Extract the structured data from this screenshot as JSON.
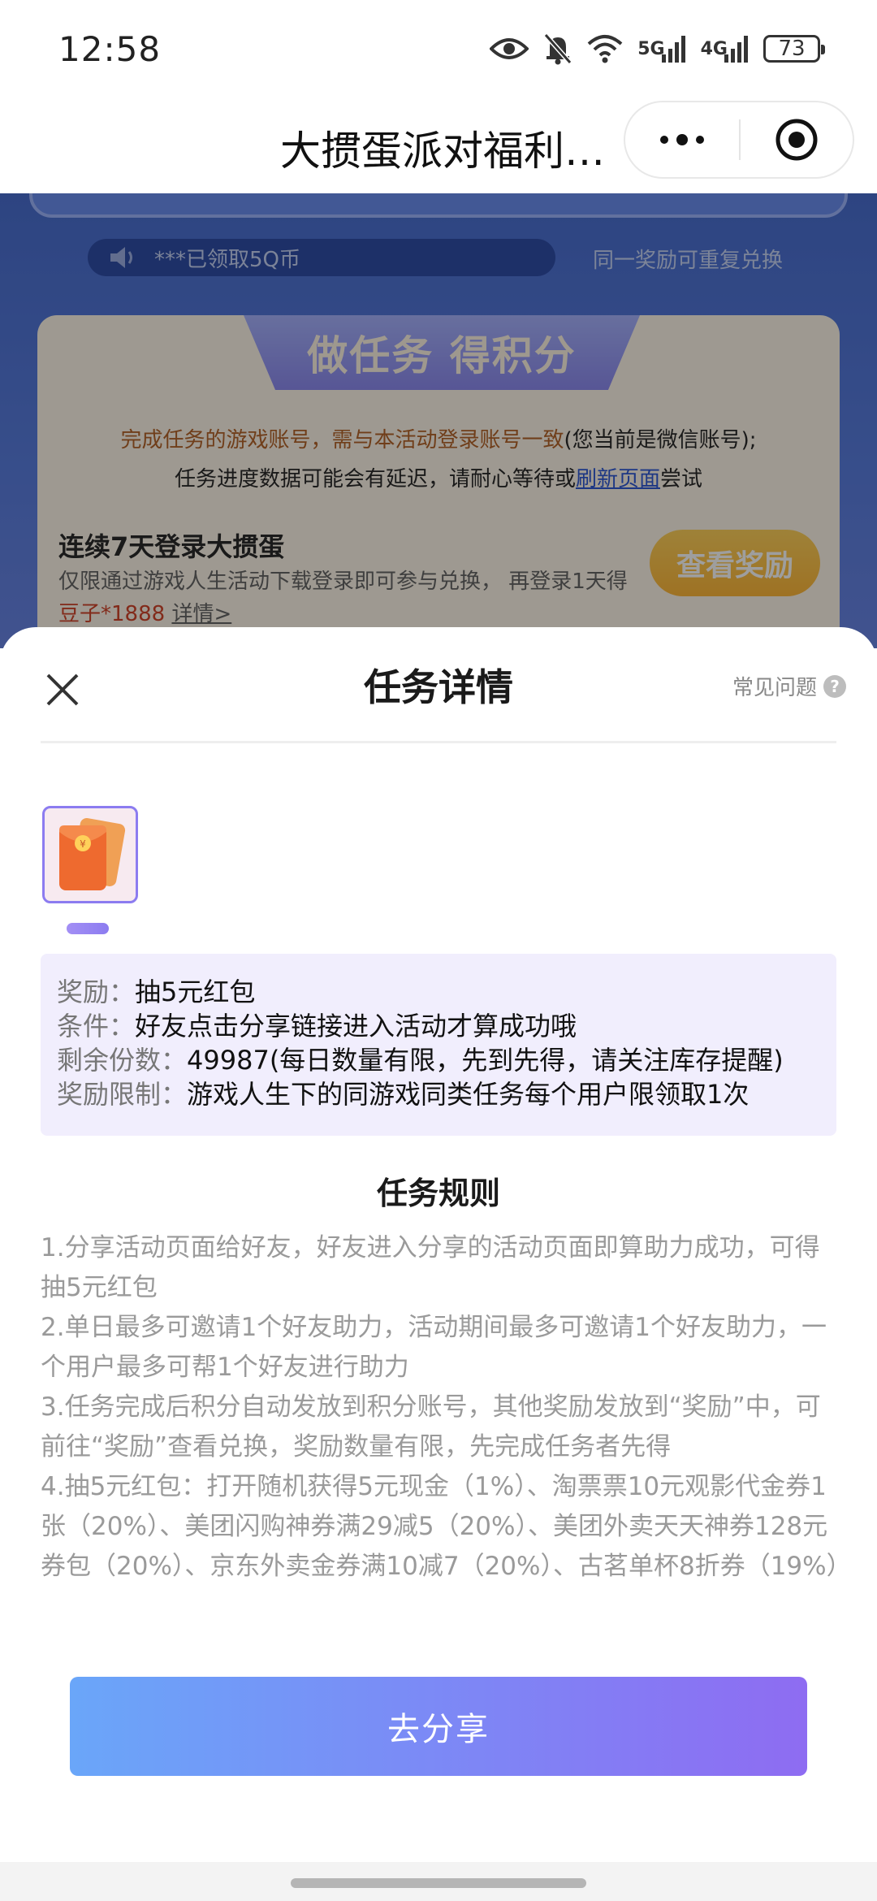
{
  "status_bar": {
    "time": "12:58",
    "network_1": "5G",
    "network_2": "4G",
    "battery": "73",
    "icons": [
      "eye-icon",
      "bell-off-icon",
      "wifi-icon",
      "signal-icon",
      "signal-icon",
      "battery-icon"
    ]
  },
  "nav": {
    "title": "大掼蛋派对福利…",
    "more_icon": "more-dots-icon",
    "close_icon": "target-close-icon"
  },
  "background": {
    "marquee_text": "***已领取5Q币",
    "repeat_text": "同一奖励可重复兑换",
    "banner": "做任务 得积分",
    "notice_warn": "完成任务的游戏账号，需与本活动登录账号一致",
    "notice_rest_1": "(您当前是微信账号);",
    "notice_line2_a": "任务进度数据可能会有延迟，请耐心等待或",
    "notice_link": "刷新页面",
    "notice_line2_b": "尝试",
    "task_title": "连续7天登录大掼蛋",
    "task_desc_a": "仅限通过游戏人生活动下载登录即可参与兑换， 再登录1天得",
    "task_desc_red": "豆子*1888",
    "task_desc_link": "详情>",
    "view_button": "查看奖励"
  },
  "sheet": {
    "title": "任务详情",
    "faq": "常见问题",
    "info": {
      "reward_key": "奖励：",
      "reward_val": "抽5元红包",
      "condition_key": "条件：",
      "condition_val": "好友点击分享链接进入活动才算成功哦",
      "remaining_key": "剩余份数：",
      "remaining_val": "49987(每日数量有限，先到先得，请关注库存提醒)",
      "limit_key": "奖励限制：",
      "limit_val": "游戏人生下的同游戏同类任务每个用户限领取1次"
    },
    "rules_title": "任务规则",
    "rules": [
      "1.分享活动页面给好友，好友进入分享的活动页面即算助力成功，可得抽5元红包",
      "2.单日最多可邀请1个好友助力，活动期间最多可邀请1个好友助力，一个用户最多可帮1个好友进行助力",
      "3.任务完成后积分自动发放到积分账号，其他奖励发放到“奖励”中，可前往“奖励”查看兑换，奖励数量有限，先完成任务者先得",
      "4.抽5元红包：打开随机获得5元现金（1%）、淘票票10元观影代金券1张（20%）、美团闪购神券满29减5（20%）、美团外卖天天神券128元券包（20%）、京东外卖金券满10减7（20%）、古茗单杯8折券（19%）"
    ],
    "share_button": "去分享"
  }
}
